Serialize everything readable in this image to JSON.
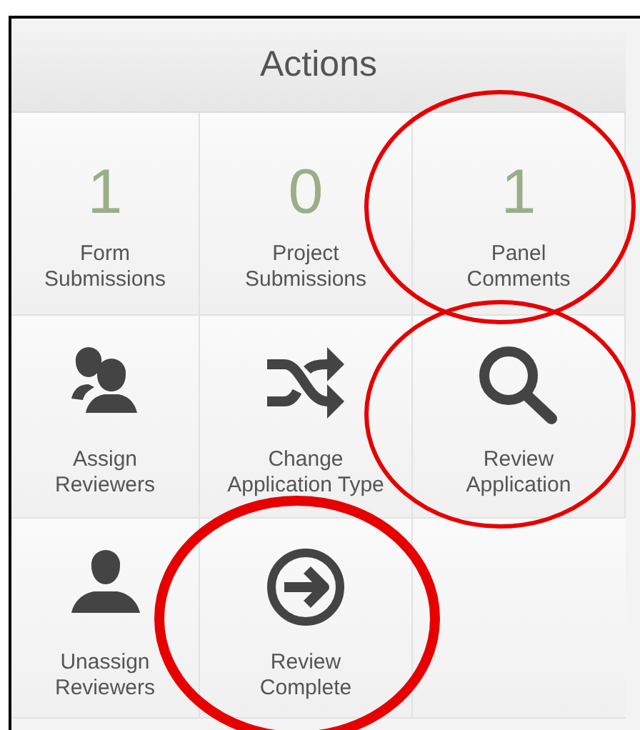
{
  "panel": {
    "title": "Actions"
  },
  "tiles": [
    {
      "kind": "count",
      "count": "1",
      "label": "Form Submissions",
      "circled": false
    },
    {
      "kind": "count",
      "count": "0",
      "label": "Project Submissions",
      "circled": false
    },
    {
      "kind": "count",
      "count": "1",
      "label": "Panel Comments",
      "circled": true,
      "heavy": false
    },
    {
      "kind": "people",
      "label": "Assign Reviewers",
      "circled": false
    },
    {
      "kind": "shuffle",
      "label": "Change Application Type",
      "circled": false
    },
    {
      "kind": "search",
      "label": "Review Application",
      "circled": true,
      "heavy": false
    },
    {
      "kind": "person",
      "label": "Unassign Reviewers",
      "circled": false
    },
    {
      "kind": "arrow",
      "label": "Review Complete",
      "circled": true,
      "heavy": true
    }
  ]
}
